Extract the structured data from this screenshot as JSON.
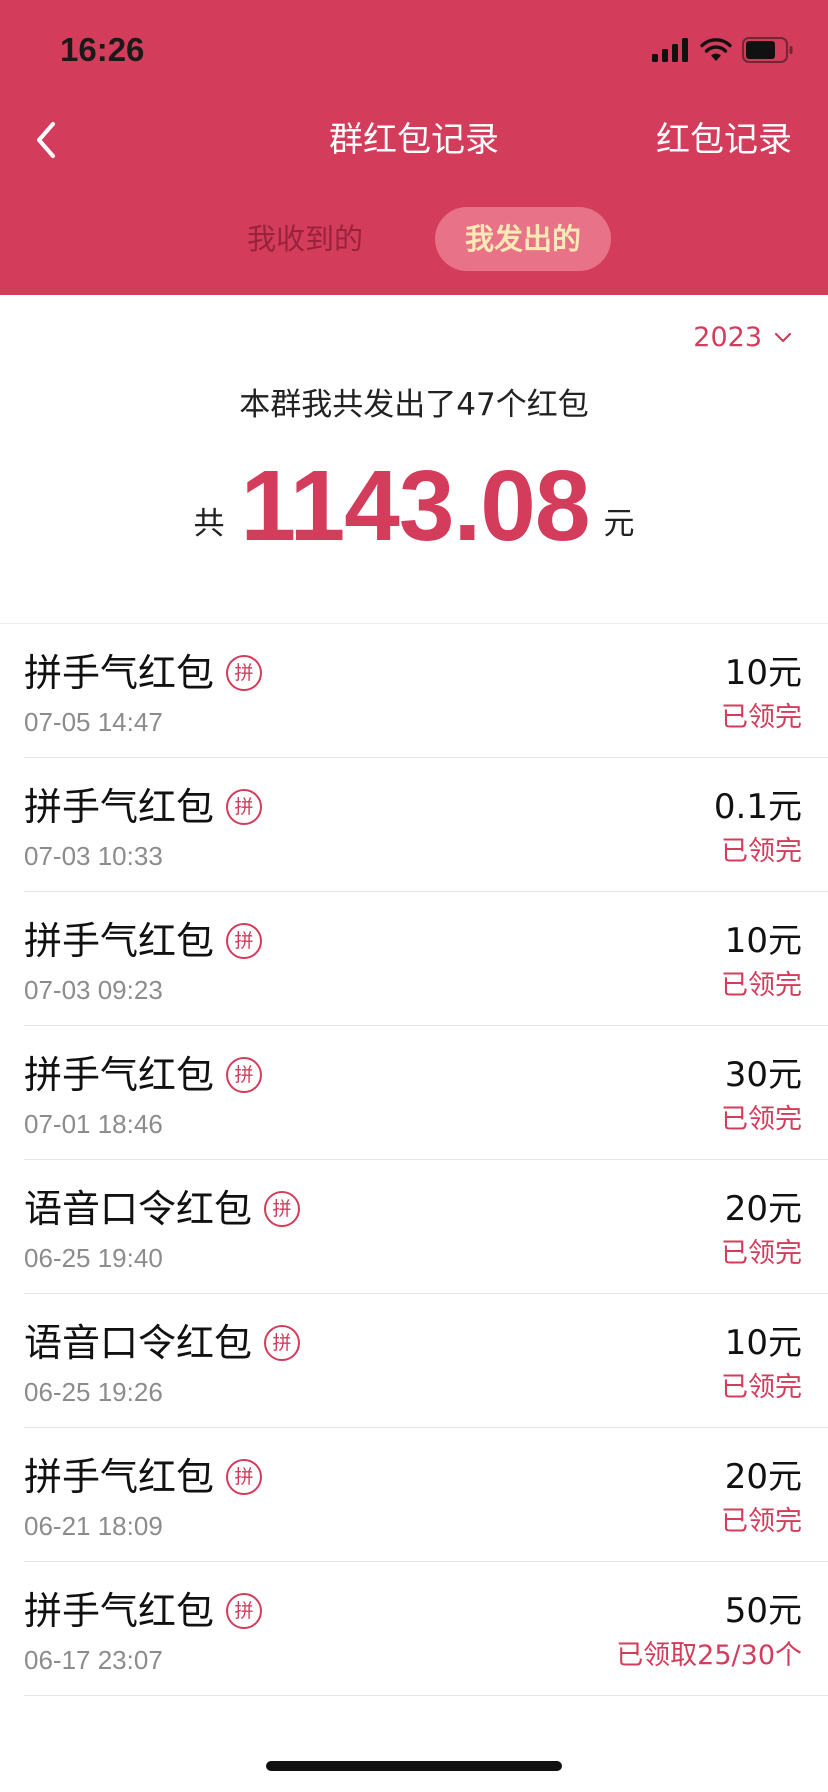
{
  "status_bar": {
    "time": "16:26"
  },
  "nav": {
    "title": "群红包记录",
    "right_link": "红包记录"
  },
  "tabs": [
    {
      "label": "我收到的",
      "selected": false
    },
    {
      "label": "我发出的",
      "selected": true
    }
  ],
  "filter": {
    "year": "2023"
  },
  "summary": {
    "text": "本群我共发出了47个红包",
    "total_prefix": "共",
    "total_amount": "1143.08",
    "total_unit": "元"
  },
  "records": [
    {
      "name": "拼手气红包",
      "badge": "拼",
      "time": "07-05 14:47",
      "amount": "10元",
      "status": "已领完"
    },
    {
      "name": "拼手气红包",
      "badge": "拼",
      "time": "07-03 10:33",
      "amount": "0.1元",
      "status": "已领完"
    },
    {
      "name": "拼手气红包",
      "badge": "拼",
      "time": "07-03 09:23",
      "amount": "10元",
      "status": "已领完"
    },
    {
      "name": "拼手气红包",
      "badge": "拼",
      "time": "07-01 18:46",
      "amount": "30元",
      "status": "已领完"
    },
    {
      "name": "语音口令红包",
      "badge": "拼",
      "time": "06-25 19:40",
      "amount": "20元",
      "status": "已领完"
    },
    {
      "name": "语音口令红包",
      "badge": "拼",
      "time": "06-25 19:26",
      "amount": "10元",
      "status": "已领完"
    },
    {
      "name": "拼手气红包",
      "badge": "拼",
      "time": "06-21 18:09",
      "amount": "20元",
      "status": "已领完"
    },
    {
      "name": "拼手气红包",
      "badge": "拼",
      "time": "06-17 23:07",
      "amount": "50元",
      "status": "已领取25/30个"
    }
  ],
  "colors": {
    "brand_red": "#d43c5b",
    "tab_highlight_bg": "#e87287",
    "tab_highlight_text": "#fde9b5"
  },
  "icons": {
    "back": "chevron-left-icon",
    "year_dropdown": "chevron-down-icon",
    "signal": "cellular-signal-icon",
    "wifi": "wifi-icon",
    "battery": "battery-icon"
  }
}
